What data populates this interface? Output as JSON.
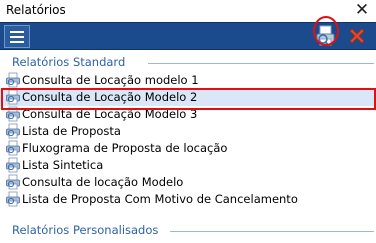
{
  "window": {
    "title": "Relatórios",
    "close_glyph": "✕"
  },
  "toolbar": {
    "menu_icon": "hamburger-menu-icon",
    "print_icon": "print-preview-icon",
    "cancel_icon": "red-x-icon",
    "print_highlight_color": "#e01010"
  },
  "groups": {
    "standard": "Relatórios Standard",
    "custom": "Relatórios Personalisados"
  },
  "items": [
    {
      "label": "Consulta de Locação modelo 1",
      "selected": false
    },
    {
      "label": "Consulta de Locação Modelo 2",
      "selected": true
    },
    {
      "label": "Consulta de Locação Modelo 3",
      "selected": false
    },
    {
      "label": "Lista de Proposta",
      "selected": false
    },
    {
      "label": "Fluxograma de Proposta de locação",
      "selected": false
    },
    {
      "label": "Lista Sintetica",
      "selected": false
    },
    {
      "label": "Consulta de locação Modelo",
      "selected": false
    },
    {
      "label": "Lista de Proposta Com Motivo de Cancelamento",
      "selected": false
    }
  ],
  "colors": {
    "toolbar_bg": "#1b4b8c",
    "group_header": "#2c62a8",
    "selected_row": "#d9e7f8",
    "highlight_red": "#e01010"
  }
}
